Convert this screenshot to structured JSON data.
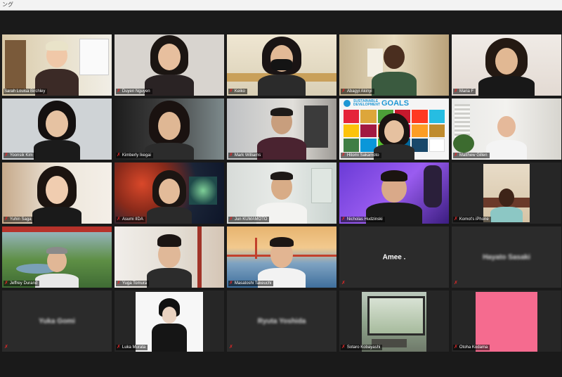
{
  "window": {
    "title": "ング"
  },
  "participants": [
    {
      "name": "Sarah Louisa Birchley",
      "muted": false
    },
    {
      "name": "Duyen Nguyen",
      "muted": true
    },
    {
      "name": "Keiko",
      "muted": true
    },
    {
      "name": "Abagyi Akinyi",
      "muted": true
    },
    {
      "name": "Maria F",
      "muted": true
    },
    {
      "name": "Yoonsik Kim",
      "muted": true
    },
    {
      "name": "Kimberly Ikegai",
      "muted": true
    },
    {
      "name": "Mark Williams",
      "muted": true
    },
    {
      "name": "Hitomi Sakamoto",
      "muted": true
    },
    {
      "name": "Matthew Gillen",
      "muted": true
    },
    {
      "name": "Yuhin Saga",
      "muted": true
    },
    {
      "name": "Asumi IIDA",
      "muted": true
    },
    {
      "name": "Jun KUMAMOTO",
      "muted": true
    },
    {
      "name": "Nicholas Hudzinski",
      "muted": true
    },
    {
      "name": "Komot's iPhone",
      "muted": true
    },
    {
      "name": "Jeffrey Durand",
      "muted": true
    },
    {
      "name": "Yuga Tomura",
      "muted": true
    },
    {
      "name": "Masatoshi Takeuchi",
      "muted": true
    },
    {
      "name": "Amee .",
      "muted": true
    },
    {
      "name": "Hayato Sasaki",
      "muted": true
    },
    {
      "name": "Yuka Gomi",
      "muted": true
    },
    {
      "name": "Luka Murata",
      "muted": true
    },
    {
      "name": "Ryuta Yoshida",
      "muted": true
    },
    {
      "name": "Sotaro Kobayashi",
      "muted": true
    },
    {
      "name": "Otoha Kodama",
      "muted": true
    }
  ],
  "sdg_banner": {
    "line1": "SUSTAINABLE",
    "line2": "DEVELOPMENT",
    "word": "GOALS"
  },
  "icons": {
    "mic_off": "✗"
  },
  "colors": {
    "active_speaker": "#cfe36b",
    "mic_off": "#e02828",
    "sdg_blue": "#1f97d4"
  }
}
